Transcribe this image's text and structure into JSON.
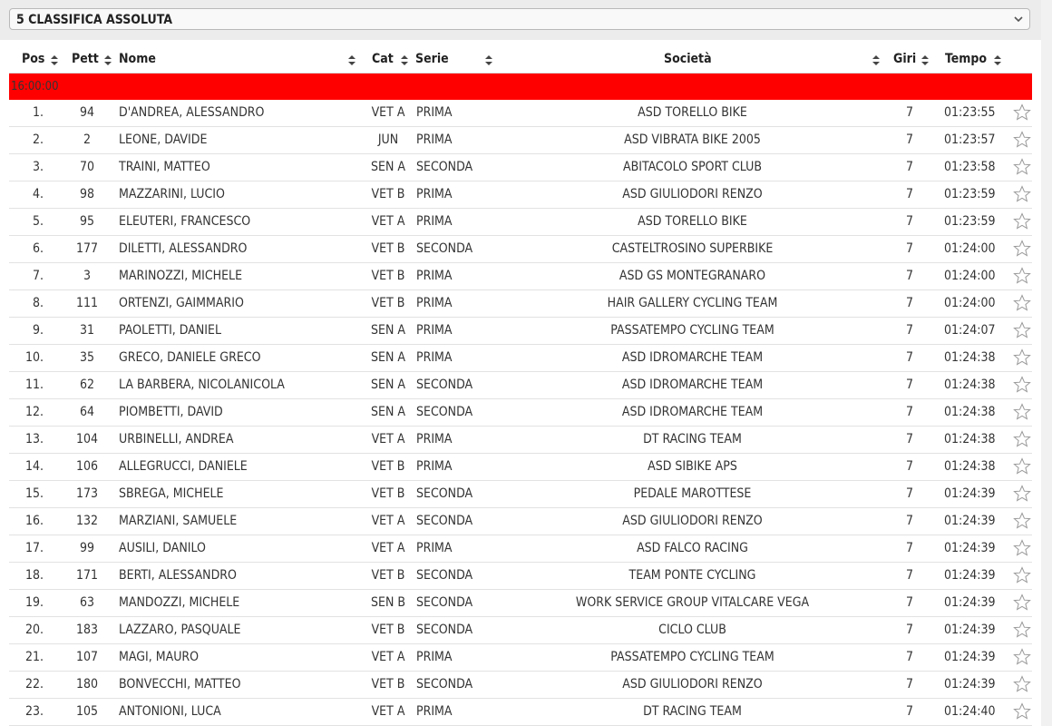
{
  "header_select": {
    "value": "5 CLASSIFICA ASSOLUTA"
  },
  "columns": {
    "pos": "Pos",
    "pett": "Pett",
    "nome": "Nome",
    "cat": "Cat",
    "serie": "Serie",
    "societa": "Società",
    "giri": "Giri",
    "tempo": "Tempo"
  },
  "group_label": "16:00:00",
  "colors": {
    "group_bar": "#ff0000"
  },
  "icons": {
    "row_action": "star-outline-icon",
    "sort": "sort-arrows-icon",
    "select": "chevron-down-icon"
  },
  "rows": [
    {
      "pos": "1.",
      "pett": "94",
      "nome": "D'ANDREA, ALESSANDRO",
      "cat": "VET A",
      "serie": "PRIMA",
      "societa": "ASD TORELLO BIKE",
      "giri": "7",
      "tempo": "01:23:55"
    },
    {
      "pos": "2.",
      "pett": "2",
      "nome": "LEONE, DAVIDE",
      "cat": "JUN",
      "serie": "PRIMA",
      "societa": "ASD VIBRATA BIKE 2005",
      "giri": "7",
      "tempo": "01:23:57"
    },
    {
      "pos": "3.",
      "pett": "70",
      "nome": "TRAINI, MATTEO",
      "cat": "SEN A",
      "serie": "SECONDA",
      "societa": "ABITACOLO SPORT CLUB",
      "giri": "7",
      "tempo": "01:23:58"
    },
    {
      "pos": "4.",
      "pett": "98",
      "nome": "MAZZARINI, LUCIO",
      "cat": "VET B",
      "serie": "PRIMA",
      "societa": "ASD GIULIODORI RENZO",
      "giri": "7",
      "tempo": "01:23:59"
    },
    {
      "pos": "5.",
      "pett": "95",
      "nome": "ELEUTERI, FRANCESCO",
      "cat": "VET A",
      "serie": "PRIMA",
      "societa": "ASD TORELLO BIKE",
      "giri": "7",
      "tempo": "01:23:59"
    },
    {
      "pos": "6.",
      "pett": "177",
      "nome": "DILETTI, ALESSANDRO",
      "cat": "VET B",
      "serie": "SECONDA",
      "societa": "CASTELTROSINO SUPERBIKE",
      "giri": "7",
      "tempo": "01:24:00"
    },
    {
      "pos": "7.",
      "pett": "3",
      "nome": "MARINOZZI, MICHELE",
      "cat": "VET B",
      "serie": "PRIMA",
      "societa": "ASD GS MONTEGRANARO",
      "giri": "7",
      "tempo": "01:24:00"
    },
    {
      "pos": "8.",
      "pett": "111",
      "nome": "ORTENZI, GAIMMARIO",
      "cat": "VET B",
      "serie": "PRIMA",
      "societa": "HAIR GALLERY CYCLING TEAM",
      "giri": "7",
      "tempo": "01:24:00"
    },
    {
      "pos": "9.",
      "pett": "31",
      "nome": "PAOLETTI, DANIEL",
      "cat": "SEN A",
      "serie": "PRIMA",
      "societa": "PASSATEMPO CYCLING TEAM",
      "giri": "7",
      "tempo": "01:24:07"
    },
    {
      "pos": "10.",
      "pett": "35",
      "nome": "GRECO, DANIELE GRECO",
      "cat": "SEN A",
      "serie": "PRIMA",
      "societa": "ASD IDROMARCHE TEAM",
      "giri": "7",
      "tempo": "01:24:38"
    },
    {
      "pos": "11.",
      "pett": "62",
      "nome": "LA BARBERA, NICOLANICOLA",
      "cat": "SEN A",
      "serie": "SECONDA",
      "societa": "ASD IDROMARCHE TEAM",
      "giri": "7",
      "tempo": "01:24:38"
    },
    {
      "pos": "12.",
      "pett": "64",
      "nome": "PIOMBETTI, DAVID",
      "cat": "SEN A",
      "serie": "SECONDA",
      "societa": "ASD IDROMARCHE TEAM",
      "giri": "7",
      "tempo": "01:24:38"
    },
    {
      "pos": "13.",
      "pett": "104",
      "nome": "URBINELLI, ANDREA",
      "cat": "VET A",
      "serie": "PRIMA",
      "societa": "DT RACING TEAM",
      "giri": "7",
      "tempo": "01:24:38"
    },
    {
      "pos": "14.",
      "pett": "106",
      "nome": "ALLEGRUCCI, DANIELE",
      "cat": "VET B",
      "serie": "PRIMA",
      "societa": "ASD SIBIKE APS",
      "giri": "7",
      "tempo": "01:24:38"
    },
    {
      "pos": "15.",
      "pett": "173",
      "nome": "SBREGA, MICHELE",
      "cat": "VET B",
      "serie": "SECONDA",
      "societa": "PEDALE MAROTTESE",
      "giri": "7",
      "tempo": "01:24:39"
    },
    {
      "pos": "16.",
      "pett": "132",
      "nome": "MARZIANI, SAMUELE",
      "cat": "VET A",
      "serie": "SECONDA",
      "societa": "ASD GIULIODORI RENZO",
      "giri": "7",
      "tempo": "01:24:39"
    },
    {
      "pos": "17.",
      "pett": "99",
      "nome": "AUSILI, DANILO",
      "cat": "VET A",
      "serie": "PRIMA",
      "societa": "ASD FALCO RACING",
      "giri": "7",
      "tempo": "01:24:39"
    },
    {
      "pos": "18.",
      "pett": "171",
      "nome": "BERTI, ALESSANDRO",
      "cat": "VET B",
      "serie": "SECONDA",
      "societa": "TEAM PONTE CYCLING",
      "giri": "7",
      "tempo": "01:24:39"
    },
    {
      "pos": "19.",
      "pett": "63",
      "nome": "MANDOZZI, MICHELE",
      "cat": "SEN B",
      "serie": "SECONDA",
      "societa": "WORK SERVICE GROUP VITALCARE VEGA",
      "giri": "7",
      "tempo": "01:24:39"
    },
    {
      "pos": "20.",
      "pett": "183",
      "nome": "LAZZARO, PASQUALE",
      "cat": "VET B",
      "serie": "SECONDA",
      "societa": "CICLO CLUB",
      "giri": "7",
      "tempo": "01:24:39"
    },
    {
      "pos": "21.",
      "pett": "107",
      "nome": "MAGI, MAURO",
      "cat": "VET A",
      "serie": "PRIMA",
      "societa": "PASSATEMPO CYCLING TEAM",
      "giri": "7",
      "tempo": "01:24:39"
    },
    {
      "pos": "22.",
      "pett": "180",
      "nome": "BONVECCHI, MATTEO",
      "cat": "VET B",
      "serie": "SECONDA",
      "societa": "ASD GIULIODORI RENZO",
      "giri": "7",
      "tempo": "01:24:39"
    },
    {
      "pos": "23.",
      "pett": "105",
      "nome": "ANTONIONI, LUCA",
      "cat": "VET A",
      "serie": "PRIMA",
      "societa": "DT RACING TEAM",
      "giri": "7",
      "tempo": "01:24:40"
    }
  ]
}
